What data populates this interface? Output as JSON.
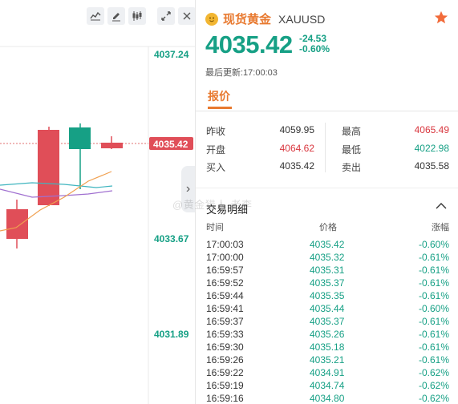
{
  "colors": {
    "up_red": "#e04e58",
    "down_green": "#16a085",
    "accent_orange": "#e8792f",
    "ma_orange": "#f0a050",
    "ma_teal": "#3fb5bf",
    "ma_purple": "#a070d0"
  },
  "chart_toolbar": {
    "icons": [
      "line-chart-icon",
      "pencil-icon",
      "candlestick-icon",
      "expand-icon",
      "close-icon"
    ]
  },
  "chart_axis": {
    "labels": [
      "4037.24",
      "4033.67",
      "4031.89"
    ],
    "current_price": "4035.42"
  },
  "quote": {
    "name": "现货黄金",
    "code": "XAUUSD",
    "last_price": "4035.42",
    "change": "-24.53",
    "change_pct": "-0.60%",
    "updated": "最后更新:17:00:03",
    "tab_label": "报价"
  },
  "stats": {
    "prev_close_label": "昨收",
    "prev_close": "4059.95",
    "open_label": "开盘",
    "open": "4064.62",
    "bid_label": "买入",
    "bid": "4035.42",
    "high_label": "最高",
    "high": "4065.49",
    "low_label": "最低",
    "low": "4022.98",
    "ask_label": "卖出",
    "ask": "4035.58"
  },
  "trades": {
    "title": "交易明细",
    "col_time": "时间",
    "col_price": "价格",
    "col_change": "涨幅",
    "rows": [
      {
        "time": "17:00:03",
        "price": "4035.42",
        "chg": "-0.60%"
      },
      {
        "time": "17:00:00",
        "price": "4035.32",
        "chg": "-0.61%"
      },
      {
        "time": "16:59:57",
        "price": "4035.31",
        "chg": "-0.61%"
      },
      {
        "time": "16:59:52",
        "price": "4035.37",
        "chg": "-0.61%"
      },
      {
        "time": "16:59:44",
        "price": "4035.35",
        "chg": "-0.61%"
      },
      {
        "time": "16:59:41",
        "price": "4035.44",
        "chg": "-0.60%"
      },
      {
        "time": "16:59:37",
        "price": "4035.37",
        "chg": "-0.61%"
      },
      {
        "time": "16:59:33",
        "price": "4035.26",
        "chg": "-0.61%"
      },
      {
        "time": "16:59:30",
        "price": "4035.18",
        "chg": "-0.61%"
      },
      {
        "time": "16:59:26",
        "price": "4035.21",
        "chg": "-0.61%"
      },
      {
        "time": "16:59:22",
        "price": "4034.91",
        "chg": "-0.62%"
      },
      {
        "time": "16:59:19",
        "price": "4034.74",
        "chg": "-0.62%"
      },
      {
        "time": "16:59:16",
        "price": "4034.80",
        "chg": "-0.62%"
      }
    ]
  },
  "watermark": "@黄金猎人-老李"
}
